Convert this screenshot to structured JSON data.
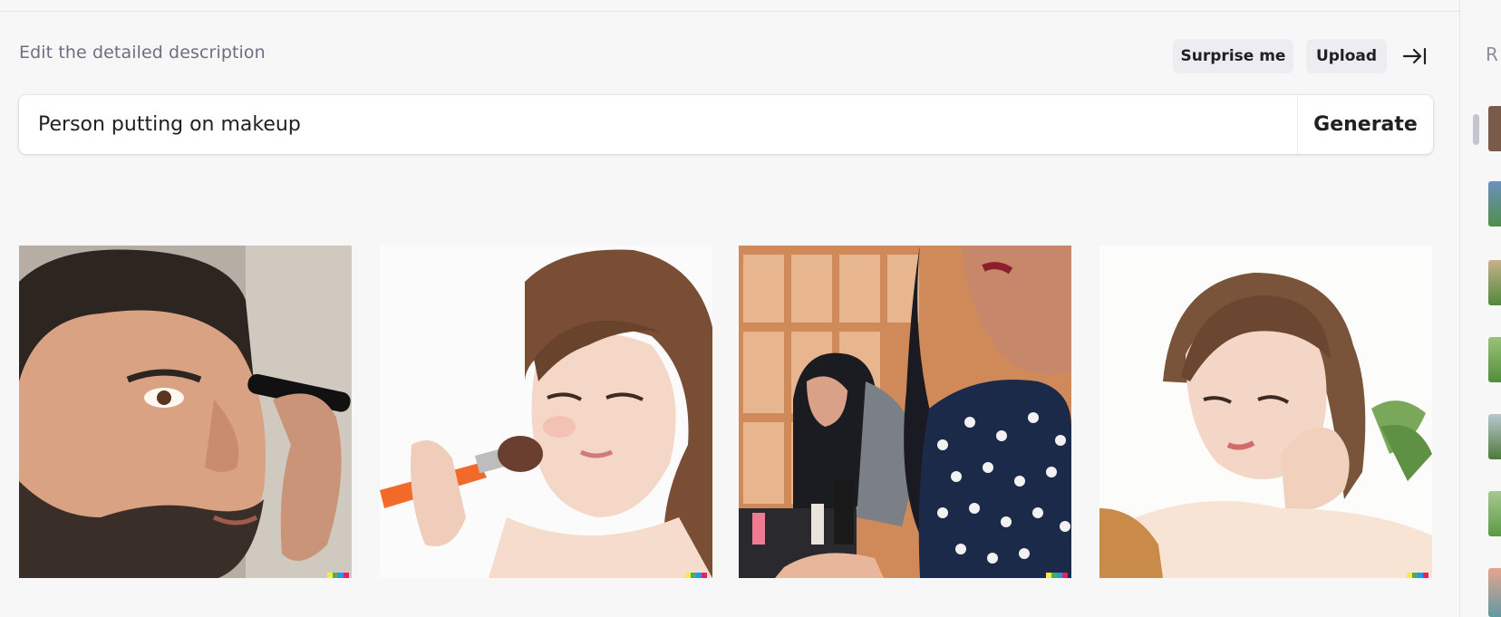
{
  "header": {
    "description_label": "Edit the detailed description",
    "surprise_label": "Surprise me",
    "upload_label": "Upload",
    "collapse_icon": "arrow-right-to-bar-icon"
  },
  "prompt": {
    "value": "Person putting on makeup",
    "generate_label": "Generate"
  },
  "results": [
    {
      "name": "result-image-1",
      "subject": "man-applying-brush"
    },
    {
      "name": "result-image-2",
      "subject": "woman-blush-brush"
    },
    {
      "name": "result-image-3",
      "subject": "women-at-mirror-polka-dot"
    },
    {
      "name": "result-image-4",
      "subject": "woman-hand-on-cheek"
    }
  ],
  "sidebar": {
    "title": "R"
  },
  "colors": {
    "background": "#f7f7f8",
    "pill": "#ececf1",
    "text": "#202123",
    "muted": "#6e6e80"
  }
}
